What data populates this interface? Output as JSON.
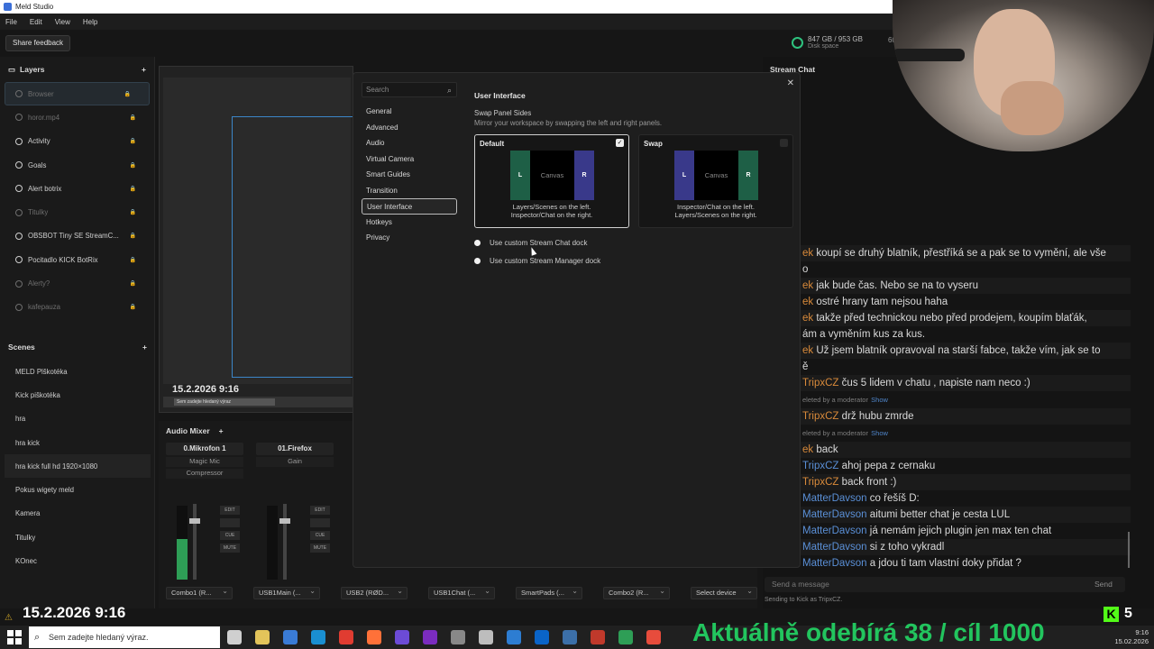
{
  "app": {
    "title": "Meld Studio"
  },
  "menu": [
    "File",
    "Edit",
    "View",
    "Help"
  ],
  "toolbar": {
    "share_feedback": "Share feedback",
    "disk_value": "847 GB / 953 GB",
    "disk_label": "Disk space",
    "fps_value": "60",
    "fps_label": "FP"
  },
  "layers": {
    "title": "Layers",
    "items": [
      {
        "label": "Browser",
        "dim": true,
        "selected": true
      },
      {
        "label": "horor.mp4",
        "dim": true
      },
      {
        "label": "Activity"
      },
      {
        "label": "Goals"
      },
      {
        "label": "Alert botrix"
      },
      {
        "label": "Titulky",
        "dim": true
      },
      {
        "label": "OBSBOT Tiny SE StreamC..."
      },
      {
        "label": "Pocitadlo KICK BotRix"
      },
      {
        "label": "Alerty?",
        "dim": true
      },
      {
        "label": "kafepauza",
        "dim": true
      }
    ]
  },
  "scenes": {
    "title": "Scenes",
    "items": [
      "MELD Plškotéka",
      "Kick piškotéka",
      "hra",
      "hra kick",
      "hra kick full hd 1920×1080",
      "Pokus wigety meld",
      "Kamera",
      "Titulky",
      "KOnec"
    ]
  },
  "preview": {
    "date": "15.2.2026 9:16",
    "mini_search": "Sem zadejte hledaný výraz"
  },
  "audio": {
    "title": "Audio Mixer",
    "channels": [
      {
        "name": "0.Mikrofon 1",
        "fx": [
          "Magic Mic",
          "Compressor"
        ],
        "level": 0.55
      },
      {
        "name": "01.Firefox",
        "fx": [
          "Gain"
        ],
        "level": 0.0
      }
    ],
    "outputs": [
      "Combo1 (R...",
      "USB1Main (...",
      "USB2 (RØD...",
      "USB1Chat (...",
      "SmartPads (...",
      "Combo2 (R...",
      "Select device"
    ],
    "btn_edit": "EDIT",
    "btn_cue": "CUE",
    "btn_mute": "MUTE"
  },
  "chat": {
    "title": "Stream Chat",
    "messages": [
      {
        "user": "ek",
        "color": "#d98a3a",
        "text": "koupí se druhý blatník, přestříká se a pak se to vymění, ale vše"
      },
      {
        "user": "",
        "color": "#d98a3a",
        "text": "o"
      },
      {
        "user": "ek",
        "color": "#d98a3a",
        "text": "jak bude čas. Nebo se na to vyseru"
      },
      {
        "user": "ek",
        "color": "#d98a3a",
        "text": "ostré hrany tam nejsou haha"
      },
      {
        "user": "ek",
        "color": "#d98a3a",
        "text": "takže před technickou nebo před prodejem, koupím blaťák,"
      },
      {
        "user": "",
        "color": "#d98a3a",
        "text": "ám a vyměním kus za kus."
      },
      {
        "user": "ek",
        "color": "#d98a3a",
        "text": "Už jsem blatník opravoval na starší fabce, takže vím, jak se to"
      },
      {
        "user": "",
        "color": "#d98a3a",
        "text": "ě"
      },
      {
        "user": "TripxCZ",
        "color": "#d98a3a",
        "text": "čus 5 lidem v chatu , napiste nam neco :)"
      },
      {
        "sys": "eleted by a moderator",
        "link": "Show"
      },
      {
        "user": "TripxCZ",
        "color": "#d98a3a",
        "text": "drž hubu zmrde"
      },
      {
        "sys": "eleted by a moderator",
        "link": "Show"
      },
      {
        "user": "ek",
        "color": "#d98a3a",
        "text": "back"
      },
      {
        "user": " TripxCZ",
        "color": "#5a8fd6",
        "text": "ahoj pepa z cernaku"
      },
      {
        "user": "TripxCZ",
        "color": "#d98a3a",
        "text": "back front :)"
      },
      {
        "user": "MatterDavson",
        "color": "#5a8fd6",
        "text": "co řešíš D:"
      },
      {
        "user": "MatterDavson",
        "color": "#5a8fd6",
        "text": "aitumi better chat je cesta LUL"
      },
      {
        "user": "MatterDavson",
        "color": "#5a8fd6",
        "text": "já nemám jejich plugin jen max ten chat"
      },
      {
        "user": "MatterDavson",
        "color": "#5a8fd6",
        "text": "si z toho vykradl"
      },
      {
        "user": "MatterDavson",
        "color": "#5a8fd6",
        "text": "a jdou ti tam vlastní doky přidat ?"
      }
    ],
    "input_placeholder": "Send a message",
    "send": "Send",
    "sending_as": "Sending to Kick as TripxCZ."
  },
  "settings": {
    "search_placeholder": "Search",
    "nav": [
      "General",
      "Advanced",
      "Audio",
      "Virtual Camera",
      "Smart Guides",
      "Transition",
      "User Interface",
      "Hotkeys",
      "Privacy"
    ],
    "active": "User Interface",
    "heading": "User Interface",
    "swap_title": "Swap Panel Sides",
    "swap_desc": "Mirror your workspace by swapping the left and right panels.",
    "cards": [
      {
        "title": "Default",
        "left": "L",
        "right": "R",
        "canvas": "Canvas",
        "line1": "Layers/Scenes on the left.",
        "line2": "Inspector/Chat on the right.",
        "checked": true,
        "lcolor": "#1e5f46",
        "rcolor": "#39398a"
      },
      {
        "title": "Swap",
        "left": "L",
        "right": "R",
        "canvas": "Canvas",
        "line1": "Inspector/Chat on the left.",
        "line2": "Layers/Scenes on the right.",
        "checked": false,
        "lcolor": "#39398a",
        "rcolor": "#1e5f46"
      }
    ],
    "options": [
      "Use custom Stream Chat dock",
      "Use custom Stream Manager dock"
    ]
  },
  "overlay": {
    "date": "15.2.2026 9:16",
    "ticker": "Aktuálně odebírá 38 / cíl 1000",
    "kick_count": "5"
  },
  "taskbar": {
    "search": "Sem zadejte hledaný výraz.",
    "time": "9:16",
    "date": "15.02.2026",
    "icon_colors": [
      "#cfcfcf",
      "#e3c45a",
      "#3a7bd5",
      "#1a8fd1",
      "#e03c31",
      "#ff7139",
      "#6c4bd6",
      "#7b2cbf",
      "#888888",
      "#bdbdbd",
      "#2d7dd2",
      "#0a64c8",
      "#3c6fa8",
      "#c0392b",
      "#2e9e56",
      "#e74c3c"
    ]
  }
}
